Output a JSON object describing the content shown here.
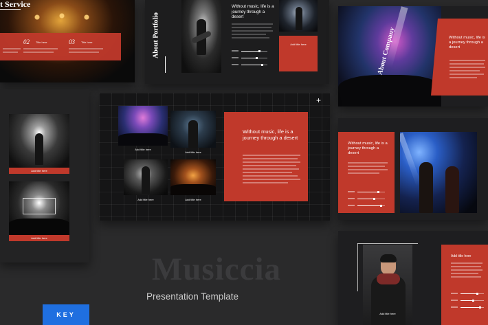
{
  "slides": {
    "service": {
      "title": "t Service",
      "steps": [
        {
          "num": "02",
          "label": "Title here"
        },
        {
          "num": "03",
          "label": "Title here"
        }
      ]
    },
    "portfolio": {
      "vertical_title": "About Portfolio",
      "quote": "Without music, life is a journey through a desert",
      "caption": "Add title here"
    },
    "company": {
      "vertical_title": "About Company",
      "quote": "Without music, life is a journey through a desert"
    },
    "gallery": {
      "quote": "Without music, life is a journey through a desert",
      "captions": [
        "Add title here",
        "Add title here",
        "Add title here",
        "Add title here"
      ]
    },
    "left_cards": {
      "captions": [
        "Add title here",
        "Add title here"
      ]
    },
    "band": {
      "quote": "Without music, life is a journey through a desert"
    },
    "profile": {
      "title": "Add title here",
      "caption": "Add title here"
    }
  },
  "brand": {
    "title": "Musiccia",
    "subtitle": "Presentation Template",
    "badge": "KEY"
  },
  "colors": {
    "accent": "#c0392b",
    "badge": "#1f6fe0",
    "background": "#2a2a2b"
  }
}
